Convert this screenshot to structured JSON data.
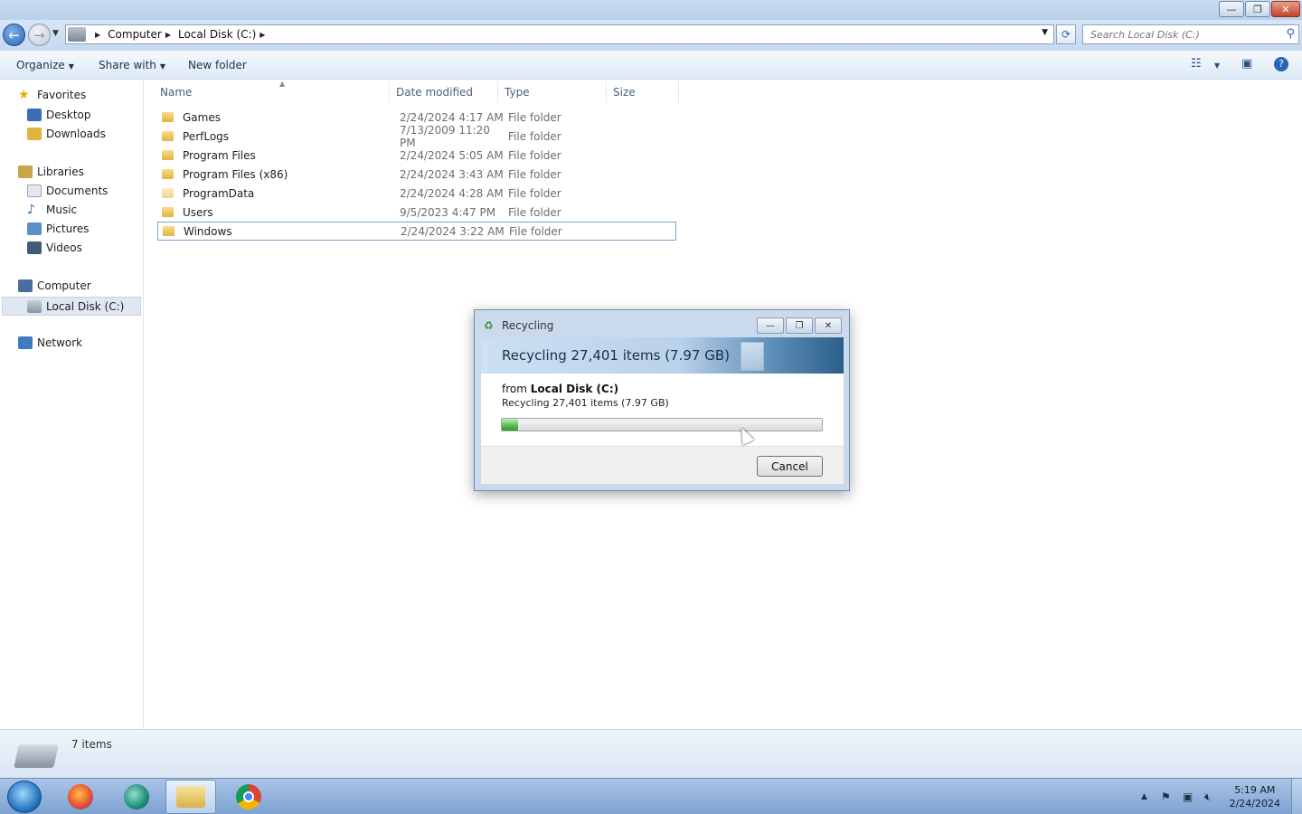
{
  "window": {
    "controls": {
      "minimize": "—",
      "maximize": "❐",
      "close": "✕"
    }
  },
  "address": {
    "breadcrumbs": [
      "Computer",
      "Local Disk (C:)"
    ],
    "search_placeholder": "Search Local Disk (C:)"
  },
  "toolbar": {
    "organize": "Organize",
    "share_with": "Share with",
    "new_folder": "New folder"
  },
  "sidebar": {
    "favorites": {
      "label": "Favorites",
      "items": [
        "Desktop",
        "Downloads"
      ]
    },
    "libraries": {
      "label": "Libraries",
      "items": [
        "Documents",
        "Music",
        "Pictures",
        "Videos"
      ]
    },
    "computer": {
      "label": "Computer",
      "items": [
        "Local Disk (C:)"
      ]
    },
    "network": {
      "label": "Network"
    }
  },
  "files": {
    "columns": [
      "Name",
      "Date modified",
      "Type",
      "Size"
    ],
    "rows": [
      {
        "name": "Games",
        "date": "2/24/2024 4:17 AM",
        "type": "File folder"
      },
      {
        "name": "PerfLogs",
        "date": "7/13/2009 11:20 PM",
        "type": "File folder"
      },
      {
        "name": "Program Files",
        "date": "2/24/2024 5:05 AM",
        "type": "File folder"
      },
      {
        "name": "Program Files (x86)",
        "date": "2/24/2024 3:43 AM",
        "type": "File folder"
      },
      {
        "name": "ProgramData",
        "date": "2/24/2024 4:28 AM",
        "type": "File folder"
      },
      {
        "name": "Users",
        "date": "9/5/2023 4:47 PM",
        "type": "File folder"
      },
      {
        "name": "Windows",
        "date": "2/24/2024 3:22 AM",
        "type": "File folder"
      }
    ]
  },
  "status": {
    "item_count": "7 items"
  },
  "dialog": {
    "title": "Recycling",
    "headline": "Recycling 27,401 items (7.97 GB)",
    "from_prefix": "from",
    "from_location": "Local Disk (C:)",
    "detail": "Recycling 27,401 items (7.97 GB)",
    "progress_percent": 5,
    "cancel": "Cancel"
  },
  "taskbar": {
    "clock_time": "5:19 AM",
    "clock_date": "2/24/2024"
  },
  "colors": {
    "accent": "#2b63b8",
    "progress": "#4dbd4d",
    "folder": "#e0b440"
  }
}
